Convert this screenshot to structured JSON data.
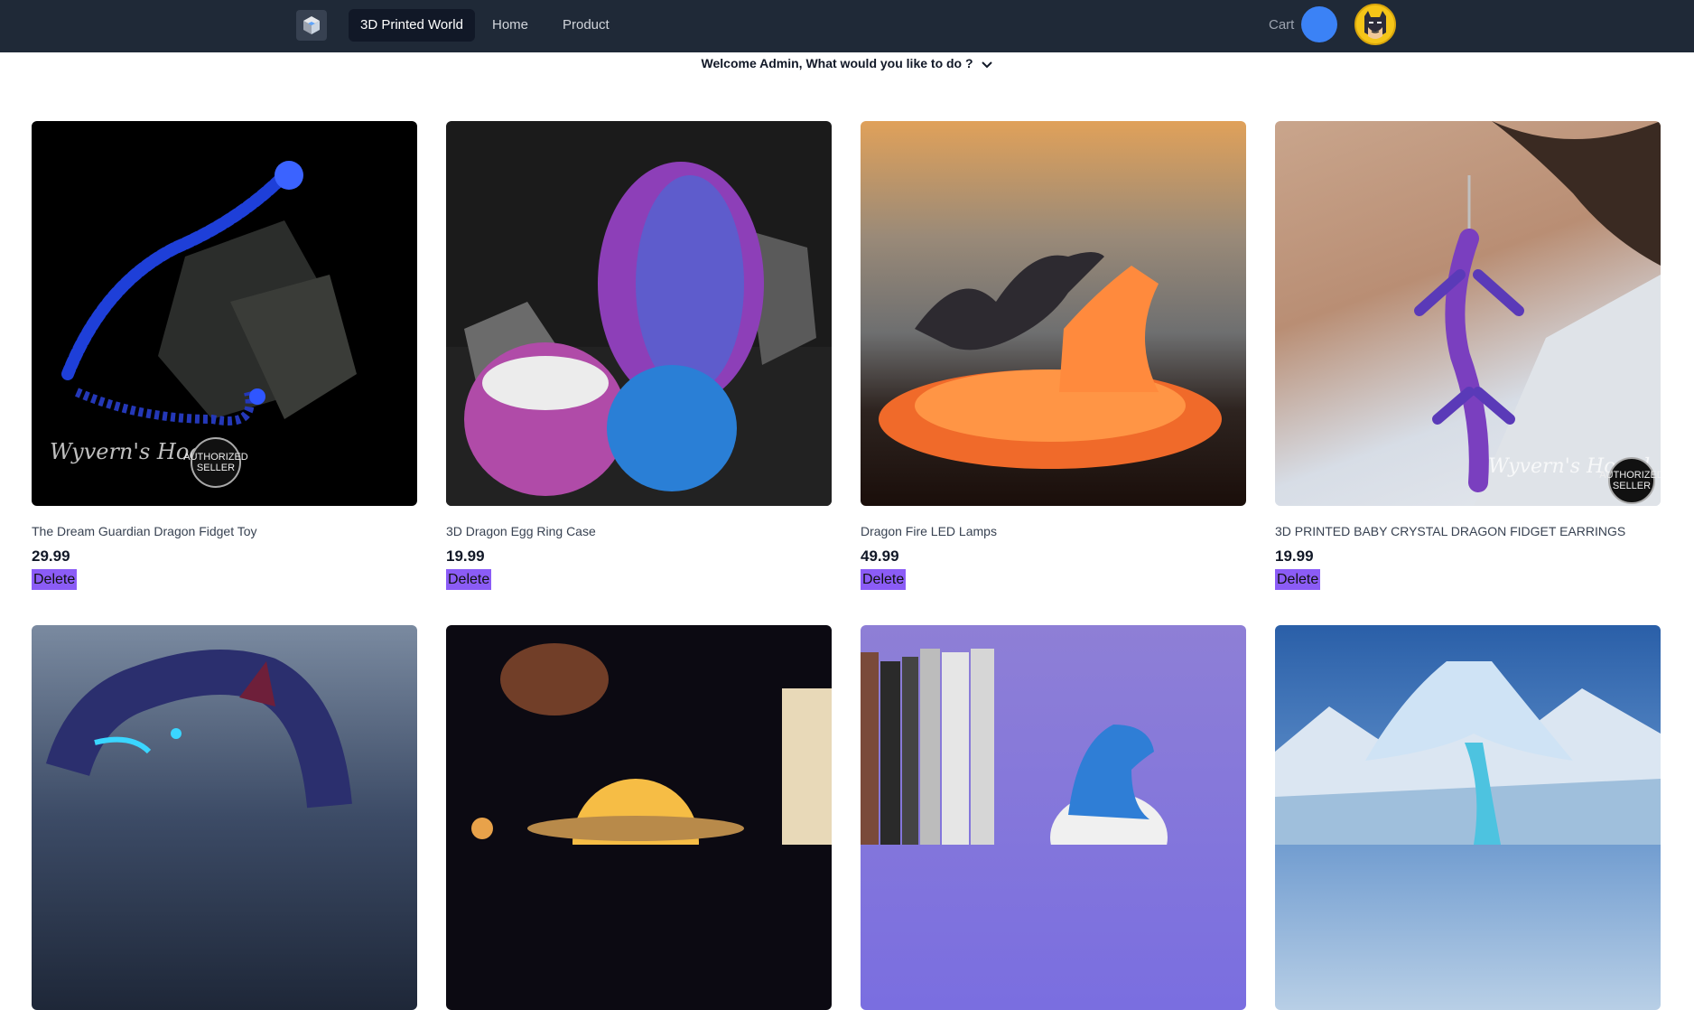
{
  "navbar": {
    "brand_label": "3D Printed World",
    "links": [
      "Home",
      "Product"
    ],
    "cart_label": "Cart"
  },
  "welcome": {
    "text": "Welcome Admin, What would you like to do ?"
  },
  "products": [
    {
      "name": "The Dream Guardian Dragon Fidget Toy",
      "price": "29.99",
      "delete_label": "Delete",
      "watermark": "Wyvern's Hoard",
      "seal": "AUTHORIZED SELLER"
    },
    {
      "name": "3D Dragon Egg Ring Case",
      "price": "19.99",
      "delete_label": "Delete"
    },
    {
      "name": "Dragon Fire LED Lamps",
      "price": "49.99",
      "delete_label": "Delete"
    },
    {
      "name": "3D PRINTED BABY CRYSTAL DRAGON FIDGET EARRINGS",
      "price": "19.99",
      "delete_label": "Delete",
      "watermark": "Wyvern's Hoard",
      "seal": "AUTHORIZED SELLER"
    }
  ],
  "colors": {
    "navbar": "#1f2937",
    "active_link_bg": "#111827",
    "cart_button": "#3b82f6",
    "delete_button": "#8b5cf6"
  },
  "icons": [
    "cube-logo-icon",
    "chevron-down-icon",
    "batman-avatar-icon"
  ]
}
